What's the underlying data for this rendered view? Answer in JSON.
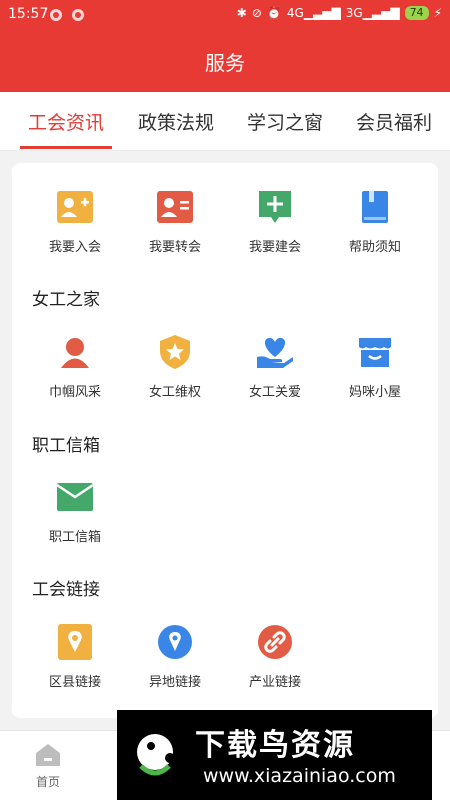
{
  "status": {
    "time": "15:57",
    "signal1": "4G",
    "signal2": "3G",
    "battery": "74"
  },
  "header": {
    "title": "服务"
  },
  "tabs": [
    {
      "label": "工会资讯"
    },
    {
      "label": "政策法规"
    },
    {
      "label": "学习之窗"
    },
    {
      "label": "会员福利"
    }
  ],
  "groups": {
    "top": [
      {
        "label": "我要入会",
        "icon": "user-add-icon",
        "color": "#f0b140"
      },
      {
        "label": "我要转会",
        "icon": "user-transfer-icon",
        "color": "#e25b44"
      },
      {
        "label": "我要建会",
        "icon": "add-comment-icon",
        "color": "#43a86a"
      },
      {
        "label": "帮助须知",
        "icon": "book-icon",
        "color": "#3a86e6"
      }
    ],
    "women": {
      "title": "女工之家",
      "items": [
        {
          "label": "巾帼风采",
          "icon": "woman-avatar-icon",
          "color": "#e25b44"
        },
        {
          "label": "女工维权",
          "icon": "shield-star-icon",
          "color": "#f0b140"
        },
        {
          "label": "女工关爱",
          "icon": "heart-hand-icon",
          "color": "#3a86e6"
        },
        {
          "label": "妈咪小屋",
          "icon": "store-icon",
          "color": "#3a86e6"
        }
      ]
    },
    "mailbox": {
      "title": "职工信箱",
      "items": [
        {
          "label": "职工信箱",
          "icon": "mail-icon",
          "color": "#43a86a"
        }
      ]
    },
    "links": {
      "title": "工会链接",
      "items": [
        {
          "label": "区县链接",
          "icon": "map-pin-icon",
          "color": "#f0b140"
        },
        {
          "label": "异地链接",
          "icon": "location-icon",
          "color": "#3a86e6"
        },
        {
          "label": "产业链接",
          "icon": "link-icon",
          "color": "#e25b44"
        }
      ]
    }
  },
  "bottom": {
    "home_label": "首页"
  },
  "watermark": {
    "text": "下载鸟资源",
    "url": "www.xiazainiao.com"
  }
}
